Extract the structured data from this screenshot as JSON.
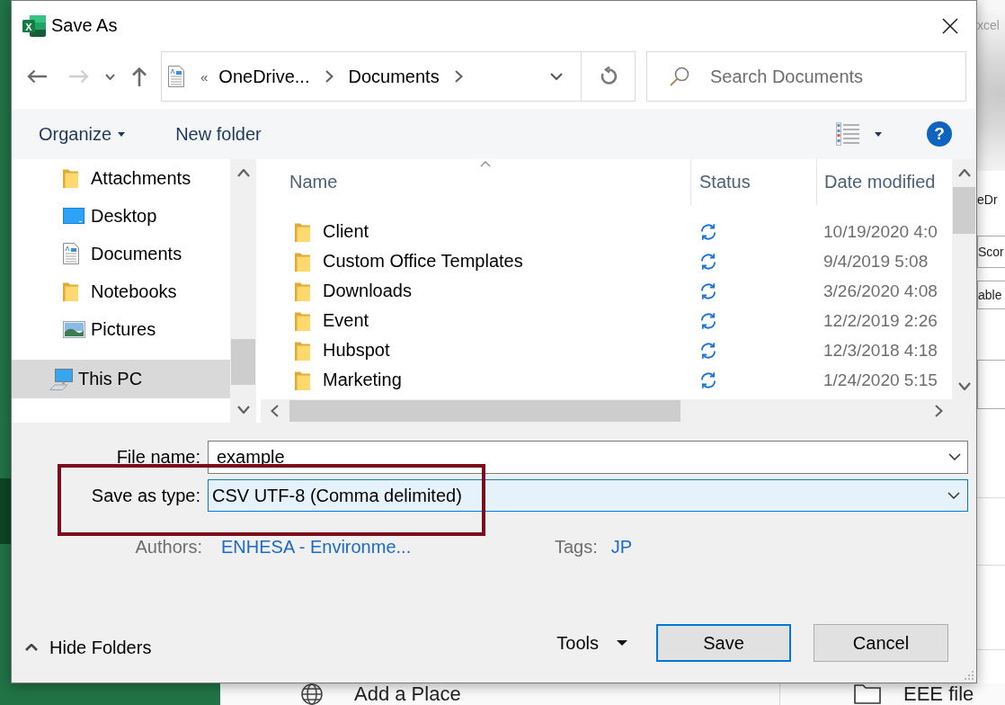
{
  "window": {
    "logo_letter": "X",
    "title": "Save As"
  },
  "nav_buttons": [
    {
      "kind": "back",
      "disabled": false
    },
    {
      "kind": "forward",
      "disabled": true
    },
    {
      "kind": "recent",
      "disabled": false
    },
    {
      "kind": "up",
      "disabled": false
    }
  ],
  "address_bar": {
    "overflow": "«",
    "crumbs": [
      "OneDrive...",
      "Documents"
    ]
  },
  "search": {
    "placeholder": "Search Documents"
  },
  "toolbar": {
    "buttons": [
      {
        "label": "Organize",
        "menu": true
      },
      {
        "label": "New folder",
        "menu": false
      }
    ],
    "help": "?"
  },
  "nav_pane": {
    "items": [
      {
        "children": [
          {
            "label": "Attachments",
            "kind": "folder",
            "selected": false
          },
          {
            "label": "Desktop",
            "kind": "desktop",
            "selected": false
          },
          {
            "label": "Documents",
            "kind": "document",
            "selected": false
          },
          {
            "label": "Notebooks",
            "kind": "folder",
            "selected": false
          },
          {
            "label": "Pictures",
            "kind": "pictures",
            "selected": false
          }
        ]
      },
      {
        "label": "This PC",
        "kind": "computer",
        "selected": true
      }
    ]
  },
  "file_list": {
    "columns": [
      {
        "label": "Name",
        "sorted": true
      },
      {
        "label": "Status",
        "sorted": false
      },
      {
        "label": "Date modified",
        "sorted": false
      }
    ],
    "rows": [
      {
        "name": "Client",
        "syncing": true,
        "date_modified": "10/19/2020 4:0"
      },
      {
        "name": "Custom Office Templates",
        "syncing": true,
        "date_modified": "9/4/2019 5:08"
      },
      {
        "name": "Downloads",
        "syncing": true,
        "date_modified": "3/26/2020 4:08"
      },
      {
        "name": "Event",
        "syncing": true,
        "date_modified": "12/2/2019 2:26"
      },
      {
        "name": "Hubspot",
        "syncing": true,
        "date_modified": "12/3/2018 4:18"
      },
      {
        "name": "Marketing",
        "syncing": true,
        "date_modified": "1/24/2020 5:15"
      }
    ]
  },
  "form": {
    "fields": [
      {
        "label": "File name:",
        "kind": "combo",
        "value": "example",
        "focused": false
      },
      {
        "label": "Save as type:",
        "kind": "select",
        "value": "CSV UTF-8 (Comma delimited)",
        "focused": true
      }
    ],
    "properties": [
      {
        "label": "Authors:",
        "value": "ENHESA - Environme..."
      },
      {
        "label": "Tags:",
        "value": "JP"
      }
    ]
  },
  "annotations": [
    {
      "kind": "rectangle"
    }
  ],
  "footer": {
    "toggle": "Hide Folders",
    "tools": "Tools",
    "buttons": [
      {
        "label": "Save",
        "default": true
      },
      {
        "label": "Cancel",
        "default": false
      }
    ]
  },
  "backdrop": {
    "corner_text": "xcel",
    "side_texts": [
      {
        "text": "eDr",
        "kind": "text"
      },
      {
        "text": "Scor",
        "kind": "box"
      },
      {
        "text": "able",
        "kind": "box"
      }
    ],
    "places": [
      {
        "label": "Add a Place",
        "kind": "globe"
      },
      {
        "label": "EEE file",
        "kind": "folder"
      }
    ]
  }
}
